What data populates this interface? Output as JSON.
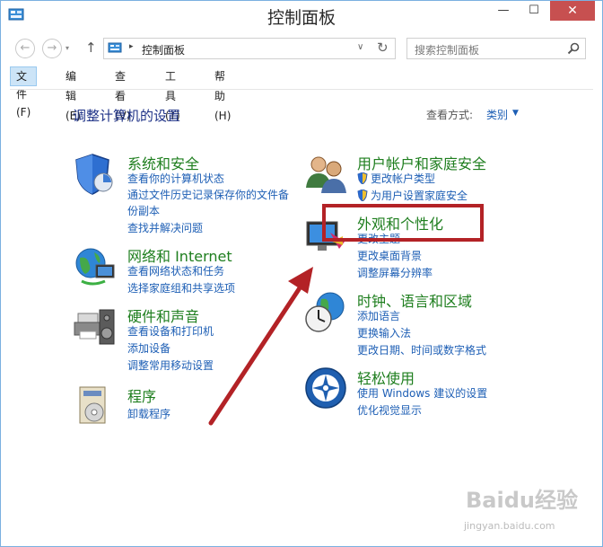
{
  "window": {
    "title": "控制面板",
    "minimize": "—",
    "maximize": "☐",
    "close": "✕"
  },
  "nav": {
    "back": "←",
    "forward": "→",
    "recent": "▾",
    "up": "↑",
    "address_separator": "▸",
    "address_text": "控制面板",
    "address_dropdown": "∨",
    "refresh": "↻",
    "search_placeholder": "搜索控制面板"
  },
  "menu": [
    "文件(F)",
    "编辑(E)",
    "查看(V)",
    "工具(T)",
    "帮助(H)"
  ],
  "content": {
    "heading": "调整计算机的设置",
    "view_by_label": "查看方式:",
    "view_by_value": "类别",
    "view_by_caret": "▼"
  },
  "categories": {
    "system": {
      "title": "系统和安全",
      "links": [
        "查看你的计算机状态",
        "通过文件历史记录保存你的文件备",
        "份副本",
        "查找并解决问题"
      ]
    },
    "network": {
      "title": "网络和 Internet",
      "links": [
        "查看网络状态和任务",
        "选择家庭组和共享选项"
      ]
    },
    "hardware": {
      "title": "硬件和声音",
      "links": [
        "查看设备和打印机",
        "添加设备",
        "调整常用移动设置"
      ]
    },
    "programs": {
      "title": "程序",
      "links": [
        "卸载程序"
      ]
    },
    "users": {
      "title": "用户帐户和家庭安全",
      "links": [
        "更改帐户类型",
        "为用户设置家庭安全"
      ]
    },
    "appearance": {
      "title": "外观和个性化",
      "links": [
        "更改主题",
        "更改桌面背景",
        "调整屏幕分辨率"
      ]
    },
    "clock": {
      "title": "时钟、语言和区域",
      "links": [
        "添加语言",
        "更换输入法",
        "更改日期、时间或数字格式"
      ]
    },
    "ease": {
      "title": "轻松使用",
      "links": [
        "使用 Windows 建议的设置",
        "优化视觉显示"
      ]
    }
  },
  "watermark": {
    "text": "Baidu经验",
    "sub": "jingyan.baidu.com"
  },
  "colors": {
    "category_title": "#1e7e1e",
    "link": "#1e5fb5",
    "heading": "#1e3287",
    "annotation_red": "#b32226",
    "close_button": "#c75050"
  }
}
